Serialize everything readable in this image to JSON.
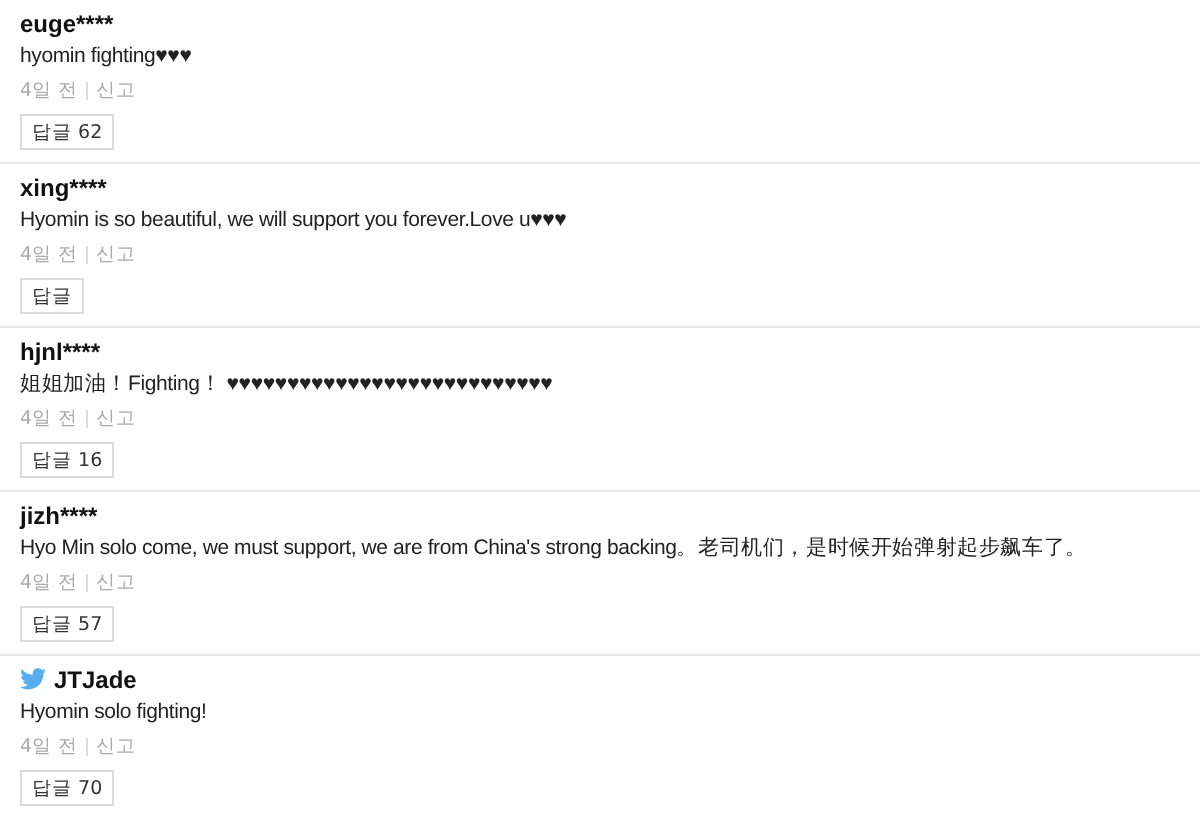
{
  "comments": [
    {
      "kind": "plain",
      "user": "euge****",
      "text": "hyomin fighting♥♥♥",
      "time": "4일 전",
      "report": "신고",
      "reply": "답글 62"
    },
    {
      "kind": "plain",
      "user": "xing****",
      "text": "Hyomin is so beautiful, we will support you forever.Love u♥♥♥",
      "time": "4일 전",
      "report": "신고",
      "reply": "답글"
    },
    {
      "kind": "plain",
      "user": "hjnl****",
      "text": "姐姐加油！Fighting！ ♥♥♥♥♥♥♥♥♥♥♥♥♥♥♥♥♥♥♥♥♥♥♥♥♥♥♥",
      "time": "4일 전",
      "report": "신고",
      "reply": "답글 16"
    },
    {
      "kind": "plain",
      "user": "jizh****",
      "text": "Hyo Min solo come, we must support, we are from China's strong backing。老司机们，是时候开始弹射起步飙车了。",
      "time": "4일 전",
      "report": "신고",
      "reply": "답글 57"
    },
    {
      "kind": "twitter",
      "user": "JTJade",
      "text": "Hyomin solo fighting!",
      "time": "4일 전",
      "report": "신고",
      "reply": "답글 70"
    }
  ]
}
